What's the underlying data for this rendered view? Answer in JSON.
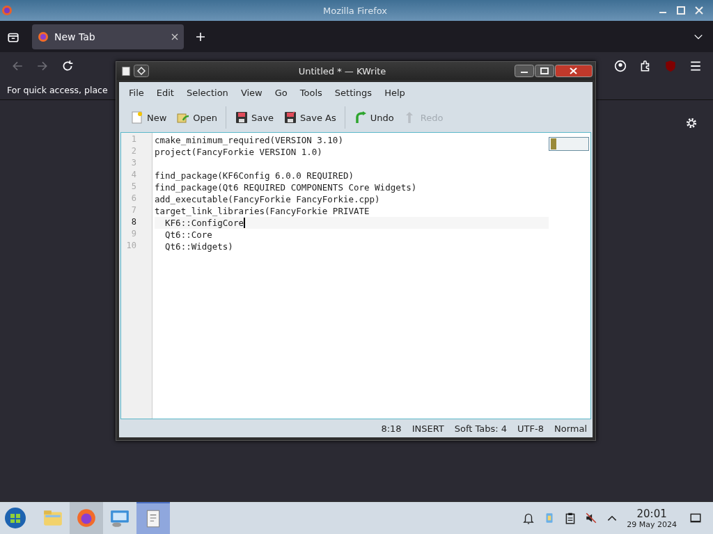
{
  "firefox": {
    "title": "Mozilla Firefox",
    "tabs": [
      {
        "label": "New Tab",
        "selected": true
      }
    ],
    "bookmarks_hint": "For quick access, place"
  },
  "kwrite": {
    "title": "Untitled * — KWrite",
    "menu": [
      "File",
      "Edit",
      "Selection",
      "View",
      "Go",
      "Tools",
      "Settings",
      "Help"
    ],
    "toolbar": [
      {
        "kind": "new",
        "label": "New",
        "disabled": false
      },
      {
        "kind": "open",
        "label": "Open",
        "disabled": false
      },
      {
        "kind": "save",
        "label": "Save",
        "disabled": false
      },
      {
        "kind": "saveas",
        "label": "Save As",
        "disabled": false
      },
      {
        "kind": "undo",
        "label": "Undo",
        "disabled": false
      },
      {
        "kind": "redo",
        "label": "Redo",
        "disabled": true
      }
    ],
    "lines": [
      {
        "number": "1",
        "text": "cmake_minimum_required(VERSION 3.10)",
        "current": false
      },
      {
        "number": "2",
        "text": "project(FancyForkie VERSION 1.0)",
        "current": false
      },
      {
        "number": "3",
        "current": false
      },
      {
        "number": "4",
        "text": "find_package(KF6Config 6.0.0 REQUIRED)",
        "current": false
      },
      {
        "number": "5",
        "text": "find_package(Qt6 REQUIRED COMPONENTS Core Widgets)",
        "current": false
      },
      {
        "number": "6",
        "text": "add_executable(FancyForkie FancyForkie.cpp)",
        "current": false
      },
      {
        "number": "7",
        "text": "target_link_libraries(FancyForkie PRIVATE",
        "current": false
      },
      {
        "number": "8",
        "text": "  KF6::ConfigCore",
        "current": true
      },
      {
        "number": "9",
        "text": "  Qt6::Core",
        "current": false
      },
      {
        "number": "10",
        "text": "  Qt6::Widgets)",
        "current": false
      }
    ],
    "status": [
      "8:18",
      "INSERT",
      "Soft Tabs: 4",
      "UTF-8",
      "Normal"
    ]
  },
  "taskbar": {
    "apps": [
      {
        "kind": "files",
        "active": false
      },
      {
        "kind": "firefox",
        "active": true
      },
      {
        "kind": "system",
        "active": false
      },
      {
        "kind": "kwrite",
        "active": true
      }
    ],
    "time": "20:01",
    "date": "29 May 2024"
  }
}
